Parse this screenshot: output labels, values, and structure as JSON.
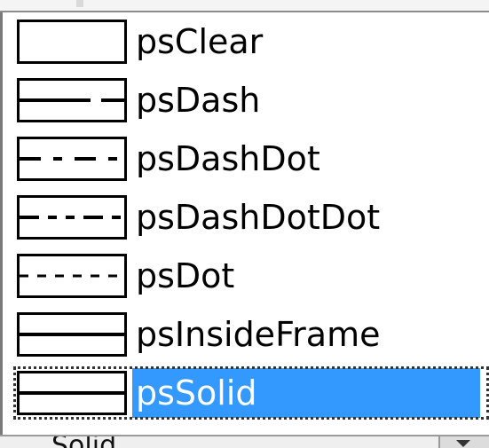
{
  "colors": {
    "selection_bg": "#3399ff",
    "selection_text": "#ffffff",
    "text": "#000000"
  },
  "pen_styles": {
    "items": [
      {
        "label": "psClear",
        "pattern": "none"
      },
      {
        "label": "psDash",
        "pattern": "dash"
      },
      {
        "label": "psDashDot",
        "pattern": "dashdot"
      },
      {
        "label": "psDashDotDot",
        "pattern": "dashdotdot"
      },
      {
        "label": "psDot",
        "pattern": "dot"
      },
      {
        "label": "psInsideFrame",
        "pattern": "solid"
      },
      {
        "label": "psSolid",
        "pattern": "solid"
      }
    ],
    "selected_label": "psSolid"
  },
  "combo": {
    "value": "Solid",
    "arrow_icon": "chevron-down-icon"
  }
}
